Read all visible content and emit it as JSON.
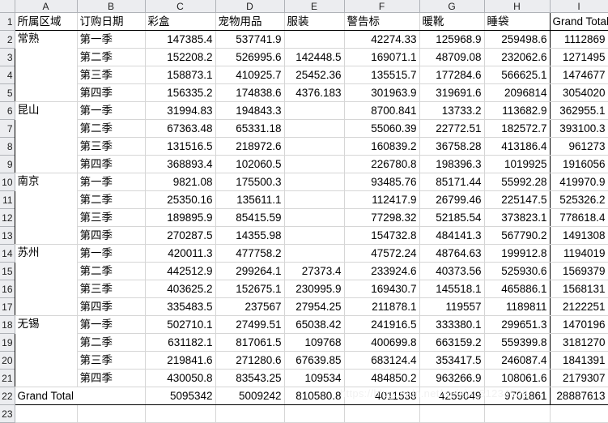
{
  "app": {
    "type": "spreadsheet-pivot-table",
    "watermark": "https://blog.csdn.net/weixin_51234503"
  },
  "column_letters": [
    "A",
    "B",
    "C",
    "D",
    "E",
    "F",
    "G",
    "H",
    "I"
  ],
  "row_numbers": [
    "1",
    "2",
    "3",
    "4",
    "5",
    "6",
    "7",
    "8",
    "9",
    "10",
    "11",
    "12",
    "13",
    "14",
    "15",
    "16",
    "17",
    "18",
    "19",
    "20",
    "21",
    "22",
    "23"
  ],
  "headers": {
    "region": "所属区域",
    "order_date": "订购日期",
    "columns": [
      "彩盒",
      "宠物用品",
      "服装",
      "警告标",
      "暖靴",
      "睡袋"
    ],
    "grand_total": "Grand Total"
  },
  "grand_total_label": "Grand Total",
  "quarters": [
    "第一季",
    "第二季",
    "第三季",
    "第四季"
  ],
  "chart_data": {
    "type": "table",
    "title": "",
    "categories": [
      "彩盒",
      "宠物用品",
      "服装",
      "警告标",
      "暖靴",
      "睡袋"
    ],
    "row_groups": [
      "常熟",
      "昆山",
      "南京",
      "苏州",
      "无锡"
    ],
    "column_totals": [
      "5095342",
      "5009242",
      "810580.8",
      "4011538",
      "4259049",
      "9701861"
    ],
    "overall_total": "28887613"
  },
  "regions": [
    {
      "name": "常熟",
      "rows": [
        {
          "quarter": "第一季",
          "values": [
            "147385.4",
            "537741.9",
            "",
            "42274.33",
            "125968.9",
            "259498.6"
          ],
          "total": "1112869"
        },
        {
          "quarter": "第二季",
          "values": [
            "152208.2",
            "526995.6",
            "142448.5",
            "169071.1",
            "48709.08",
            "232062.6"
          ],
          "total": "1271495"
        },
        {
          "quarter": "第三季",
          "values": [
            "158873.1",
            "410925.7",
            "25452.36",
            "135515.7",
            "177284.6",
            "566625.1"
          ],
          "total": "1474677"
        },
        {
          "quarter": "第四季",
          "values": [
            "156335.2",
            "174838.6",
            "4376.183",
            "301963.9",
            "319691.6",
            "2096814"
          ],
          "total": "3054020"
        }
      ]
    },
    {
      "name": "昆山",
      "rows": [
        {
          "quarter": "第一季",
          "values": [
            "31994.83",
            "194843.3",
            "",
            "8700.841",
            "13733.2",
            "113682.9"
          ],
          "total": "362955.1"
        },
        {
          "quarter": "第二季",
          "values": [
            "67363.48",
            "65331.18",
            "",
            "55060.39",
            "22772.51",
            "182572.7"
          ],
          "total": "393100.3"
        },
        {
          "quarter": "第三季",
          "values": [
            "131516.5",
            "218972.6",
            "",
            "160839.2",
            "36758.28",
            "413186.4"
          ],
          "total": "961273"
        },
        {
          "quarter": "第四季",
          "values": [
            "368893.4",
            "102060.5",
            "",
            "226780.8",
            "198396.3",
            "1019925"
          ],
          "total": "1916056"
        }
      ]
    },
    {
      "name": "南京",
      "rows": [
        {
          "quarter": "第一季",
          "values": [
            "9821.08",
            "175500.3",
            "",
            "93485.76",
            "85171.44",
            "55992.28"
          ],
          "total": "419970.9"
        },
        {
          "quarter": "第二季",
          "values": [
            "25350.16",
            "135611.1",
            "",
            "112417.9",
            "26799.46",
            "225147.5"
          ],
          "total": "525326.2"
        },
        {
          "quarter": "第三季",
          "values": [
            "189895.9",
            "85415.59",
            "",
            "77298.32",
            "52185.54",
            "373823.1"
          ],
          "total": "778618.4"
        },
        {
          "quarter": "第四季",
          "values": [
            "270287.5",
            "14355.98",
            "",
            "154732.8",
            "484141.3",
            "567790.2"
          ],
          "total": "1491308"
        }
      ]
    },
    {
      "name": "苏州",
      "rows": [
        {
          "quarter": "第一季",
          "values": [
            "420011.3",
            "477758.2",
            "",
            "47572.24",
            "48764.63",
            "199912.8"
          ],
          "total": "1194019"
        },
        {
          "quarter": "第二季",
          "values": [
            "442512.9",
            "299264.1",
            "27373.4",
            "233924.6",
            "40373.56",
            "525930.6"
          ],
          "total": "1569379"
        },
        {
          "quarter": "第三季",
          "values": [
            "403625.2",
            "152675.1",
            "230995.9",
            "169430.7",
            "145518.1",
            "465886.1"
          ],
          "total": "1568131"
        },
        {
          "quarter": "第四季",
          "values": [
            "335483.5",
            "237567",
            "27954.25",
            "211878.1",
            "119557",
            "1189811"
          ],
          "total": "2122251"
        }
      ]
    },
    {
      "name": "无锡",
      "rows": [
        {
          "quarter": "第一季",
          "values": [
            "502710.1",
            "27499.51",
            "65038.42",
            "241916.5",
            "333380.1",
            "299651.3"
          ],
          "total": "1470196"
        },
        {
          "quarter": "第二季",
          "values": [
            "631182.1",
            "817061.5",
            "109768",
            "400699.8",
            "663159.2",
            "559399.8"
          ],
          "total": "3181270"
        },
        {
          "quarter": "第三季",
          "values": [
            "219841.6",
            "271280.6",
            "67639.85",
            "683124.4",
            "353417.5",
            "246087.4"
          ],
          "total": "1841391"
        },
        {
          "quarter": "第四季",
          "values": [
            "430050.8",
            "83543.25",
            "109534",
            "484850.2",
            "963266.9",
            "108061.6"
          ],
          "total": "2179307"
        }
      ]
    }
  ],
  "totals_row": {
    "label": "Grand Total",
    "values": [
      "5095342",
      "5009242",
      "810580.8",
      "4011538",
      "4259049",
      "9701861"
    ],
    "total": "28887613"
  }
}
